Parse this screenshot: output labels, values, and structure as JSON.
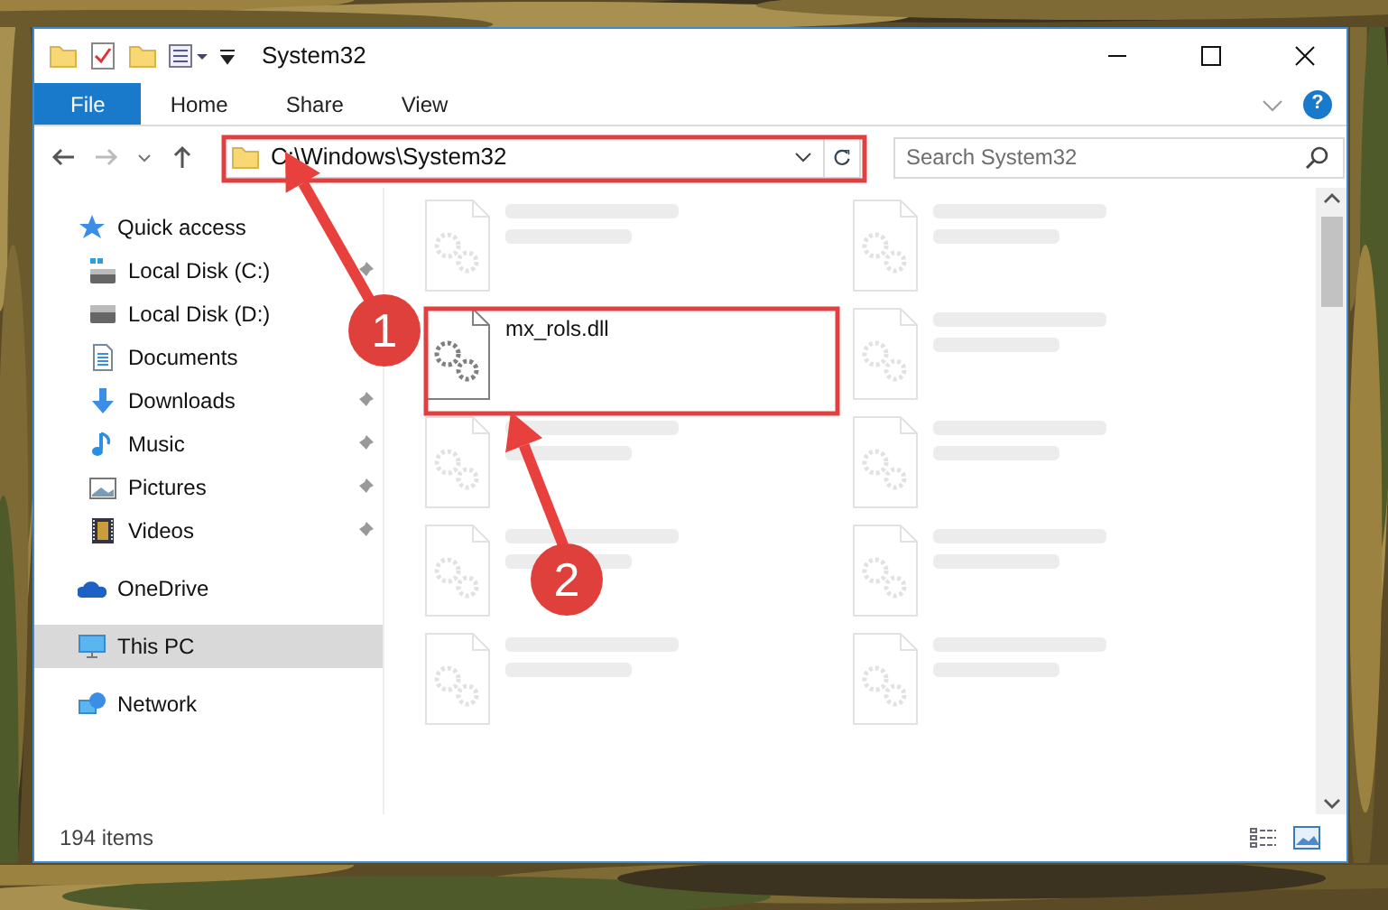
{
  "window": {
    "title": "System32"
  },
  "ribbon": {
    "tabs": [
      {
        "label": "File",
        "selected": true
      },
      {
        "label": "Home",
        "selected": false
      },
      {
        "label": "Share",
        "selected": false
      },
      {
        "label": "View",
        "selected": false
      }
    ],
    "help": "?"
  },
  "address": {
    "path": "C:\\Windows\\System32"
  },
  "search": {
    "placeholder": "Search System32"
  },
  "sidebar": {
    "items": [
      {
        "label": "Quick access",
        "selected": false,
        "children": [
          {
            "label": "Local Disk (C:)",
            "pinned": true
          },
          {
            "label": "Local Disk (D:)",
            "pinned": false
          },
          {
            "label": "Documents",
            "pinned": false
          },
          {
            "label": "Downloads",
            "pinned": true
          },
          {
            "label": "Music",
            "pinned": true
          },
          {
            "label": "Pictures",
            "pinned": true
          },
          {
            "label": "Videos",
            "pinned": true
          }
        ]
      },
      {
        "label": "OneDrive",
        "selected": false
      },
      {
        "label": "This PC",
        "selected": true
      },
      {
        "label": "Network",
        "selected": false
      }
    ]
  },
  "files": [
    {
      "faded": true
    },
    {
      "faded": true
    },
    {
      "name": "mx_rols.dll",
      "faded": false
    },
    {
      "faded": true
    },
    {
      "faded": true
    },
    {
      "faded": true
    },
    {
      "faded": true
    },
    {
      "faded": true
    },
    {
      "faded": true
    },
    {
      "faded": true
    }
  ],
  "status_bar": {
    "count": "194 items"
  },
  "annotations": [
    {
      "label": "1"
    },
    {
      "label": "2"
    }
  ]
}
